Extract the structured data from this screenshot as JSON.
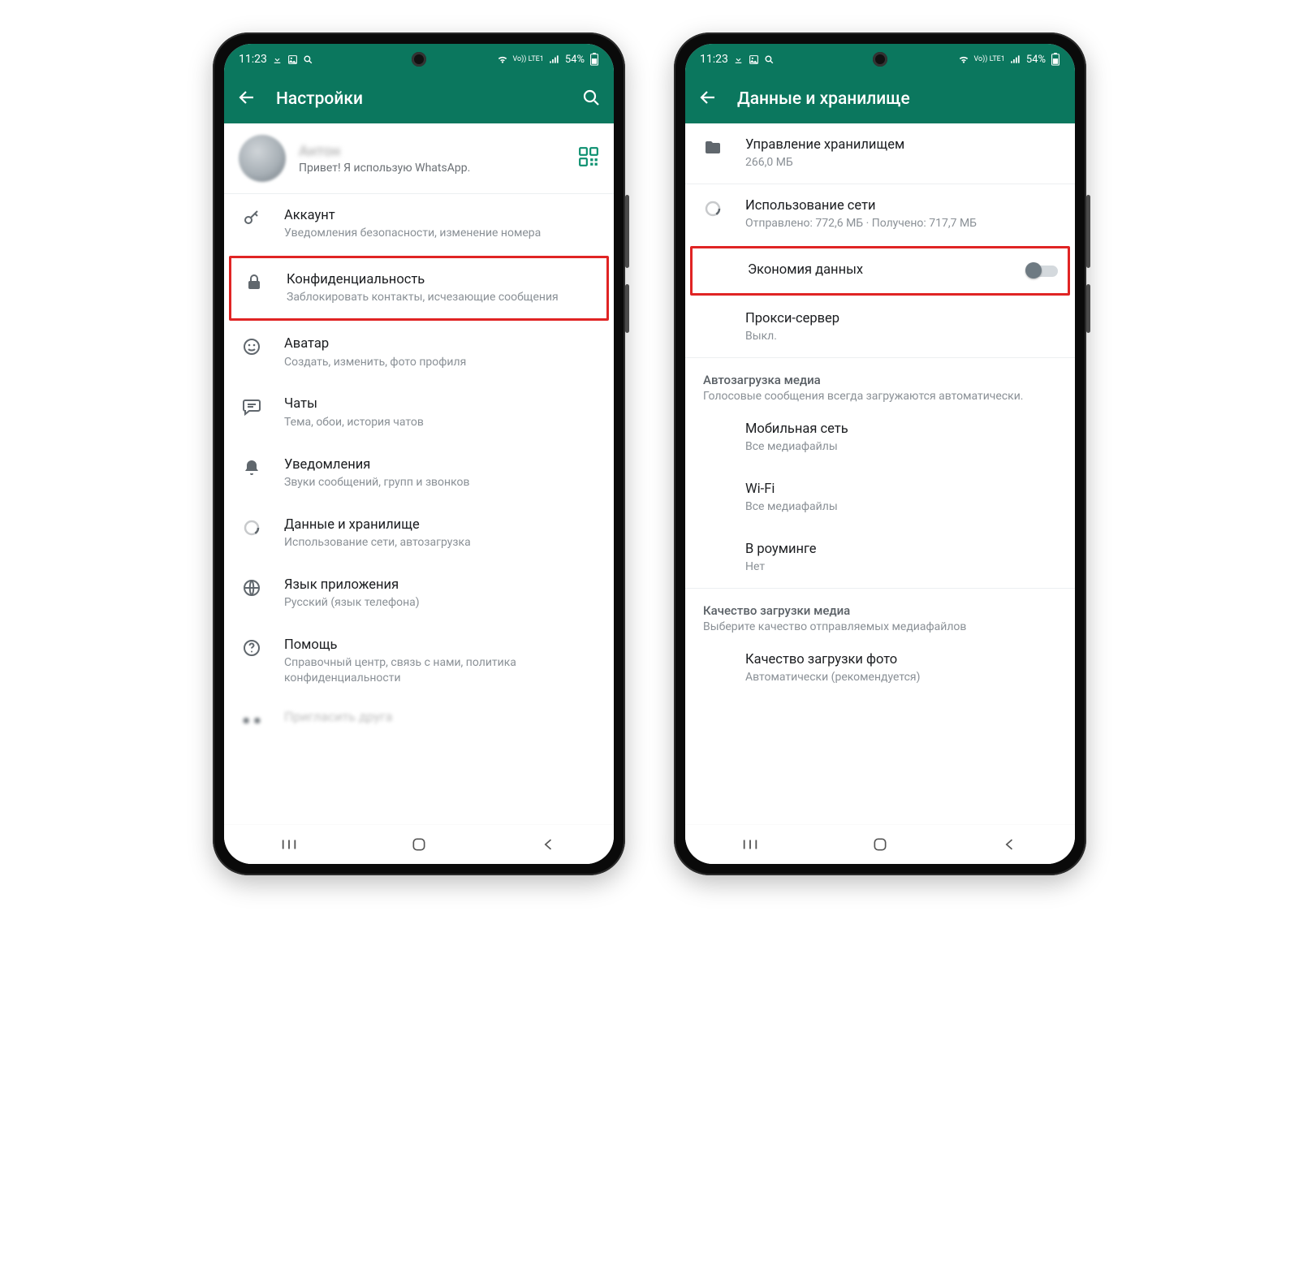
{
  "status": {
    "time": "11:23",
    "battery": "54%",
    "net_label": "Vo)) LTE1"
  },
  "phone1": {
    "title": "Настройки",
    "profile": {
      "name": "Антон",
      "status": "Привет! Я использую WhatsApp."
    },
    "items": [
      {
        "title": "Аккаунт",
        "sub": "Уведомления безопасности, изменение номера"
      },
      {
        "title": "Конфиденциальность",
        "sub": "Заблокировать контакты, исчезающие сообщения"
      },
      {
        "title": "Аватар",
        "sub": "Создать, изменить, фото профиля"
      },
      {
        "title": "Чаты",
        "sub": "Тема, обои, история чатов"
      },
      {
        "title": "Уведомления",
        "sub": "Звуки сообщений, групп и звонков"
      },
      {
        "title": "Данные и хранилище",
        "sub": "Использование сети, автозагрузка"
      },
      {
        "title": "Язык приложения",
        "sub": "Русский (язык телефона)"
      },
      {
        "title": "Помощь",
        "sub": "Справочный центр, связь с нами, политика конфиденциальности"
      }
    ],
    "cut": "Пригласить друга"
  },
  "phone2": {
    "title": "Данные и хранилище",
    "storage": {
      "title": "Управление хранилищем",
      "sub": "266,0 МБ"
    },
    "network": {
      "title": "Использование сети",
      "sub": "Отправлено: 772,6 МБ · Получено: 717,7 МБ"
    },
    "saver": {
      "title": "Экономия данных"
    },
    "proxy": {
      "title": "Прокси-сервер",
      "sub": "Выкл."
    },
    "auto": {
      "header": "Автозагрузка медиа",
      "note": "Голосовые сообщения всегда загружаются автоматически.",
      "cell": {
        "title": "Мобильная сеть",
        "sub": "Все медиафайлы"
      },
      "wifi": {
        "title": "Wi-Fi",
        "sub": "Все медиафайлы"
      },
      "roam": {
        "title": "В роуминге",
        "sub": "Нет"
      }
    },
    "quality": {
      "header": "Качество загрузки медиа",
      "note": "Выберите качество отправляемых медиафайлов",
      "photo": {
        "title": "Качество загрузки фото",
        "sub": "Автоматически (рекомендуется)"
      }
    }
  }
}
